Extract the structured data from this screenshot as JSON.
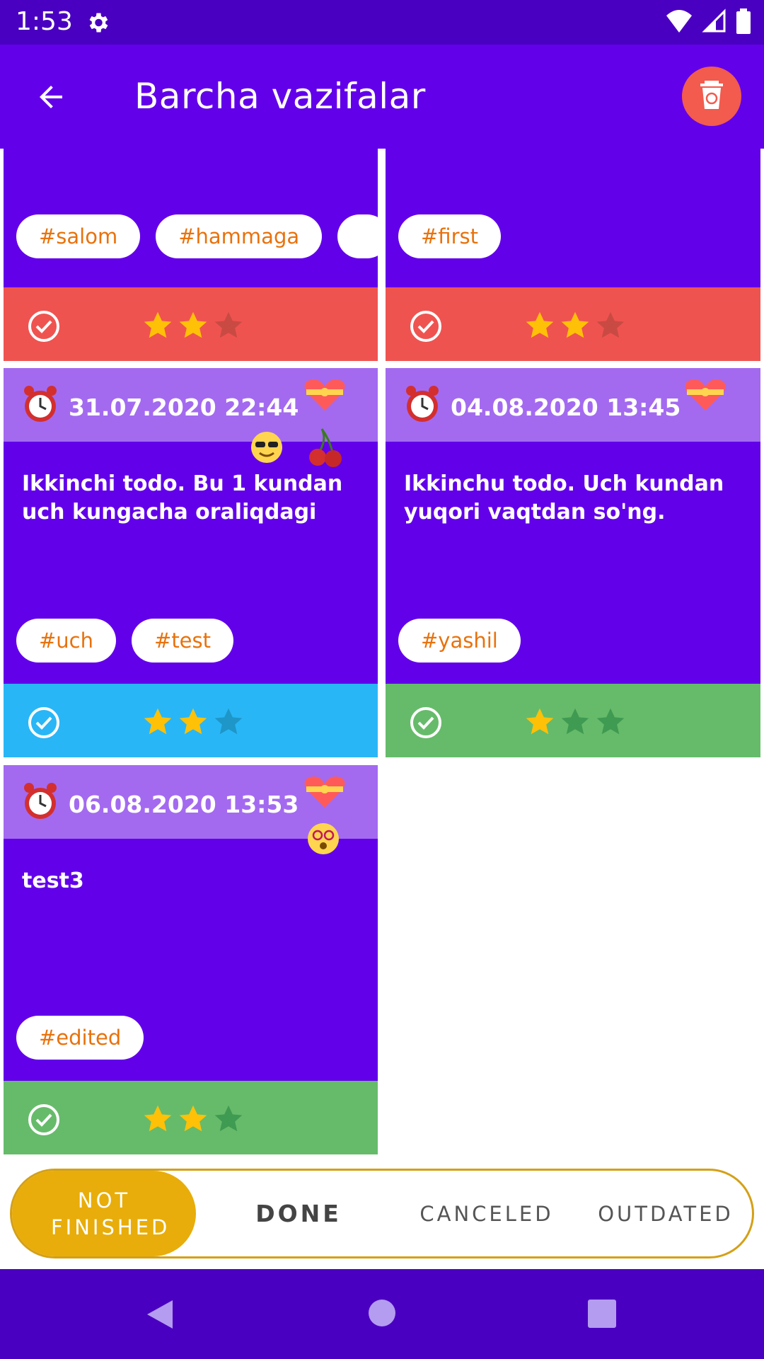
{
  "status_bar": {
    "time": "1:53",
    "icons": [
      "gear-icon",
      "wifi-icon",
      "signal-icon",
      "battery-icon"
    ]
  },
  "app_bar": {
    "title": "Barcha vazifalar",
    "back_icon": "arrow-back-icon",
    "delete_icon": "trash-icon"
  },
  "colors": {
    "primary": "#6200ea",
    "status_bar": "#4a00c0",
    "header": "#a36af0",
    "red": "#ef5350",
    "blue": "#29b6f6",
    "green": "#66bb6a",
    "accent": "#e8ad0a",
    "tag_text": "#e8720c",
    "star": "#ffc107"
  },
  "cards": [
    {
      "tags": [
        "#salom",
        "#hammaga"
      ],
      "stars": 2,
      "footer_color": "red"
    },
    {
      "tags": [
        "#first"
      ],
      "stars": 2,
      "footer_color": "red"
    },
    {
      "date": "31.07.2020 22:44",
      "text": "Ikkinchi todo. Bu 1 kundan uch kungacha oraliqdagi",
      "tags": [
        "#uch",
        "#test"
      ],
      "stars": 2,
      "footer_color": "blue",
      "emojis": [
        "sunglasses-emoji-icon",
        "cherry-icon"
      ]
    },
    {
      "date": "04.08.2020 13:45",
      "text": "Ikkinchu todo. Uch kundan yuqori vaqtdan so'ng.",
      "tags": [
        "#yashil"
      ],
      "stars": 1,
      "footer_color": "green"
    },
    {
      "date": "06.08.2020 13:53",
      "text": "test3",
      "tags": [
        "#edited"
      ],
      "stars": 2,
      "footer_color": "green",
      "emojis": [
        "dizzy-face-emoji-icon"
      ]
    }
  ],
  "filter": {
    "selected": "NOT FINISHED",
    "options": [
      "NOT FINISHED",
      "DONE",
      "CANCELED",
      "OUTDATED"
    ]
  },
  "nav_bar": {
    "icons": [
      "nav-back-icon",
      "nav-home-icon",
      "nav-recents-icon"
    ]
  }
}
